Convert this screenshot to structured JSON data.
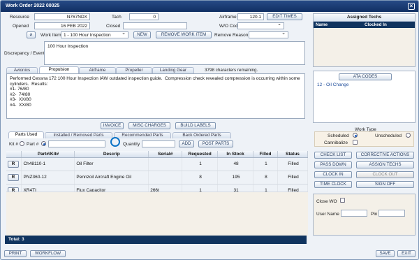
{
  "window": {
    "title": "Work Order 2022 00025",
    "close_icon": "close-icon"
  },
  "header": {
    "resource_label": "Resource",
    "resource_value": "N767NDX",
    "tach_label": "Tach",
    "tach_value": "0",
    "airframe_label": "Airframe",
    "airframe_value": "120.1",
    "edit_times": "EDIT TIMES",
    "opened_label": "Opened",
    "opened_value": "16 FEB 2022",
    "closed_label": "Closed",
    "closed_value": "",
    "wo_code_label": "W/O Code",
    "wo_code_value": ""
  },
  "workitem": {
    "label": "Work Item",
    "value": "1 - 100 Hour Inspection",
    "new_button": "NEW",
    "remove_button": "REMOVE WORK ITEM",
    "remove_reason_label": "Remove Reason",
    "remove_reason_value": ""
  },
  "discrepancy": {
    "label": "Discrepancy / Event",
    "text": "100 Hour Inspection"
  },
  "tabs": [
    "Avionics",
    "Propulsion",
    "Airframe",
    "Propeller",
    "Landing Gear"
  ],
  "chars_remaining": "3798 characters remaining.",
  "note_text": "Performed Cessna 172 100 Hour Inspection IAW outdated inspection guide.  Compression check revealed compression is occurring within some\ncylinders.  Results:\n#1- 76/80\n#2-  74/80\n#3-  XX/80\n#4-  XX/80",
  "actions": {
    "invoice": "INVOICE",
    "misc": "MISC CHARGES",
    "build": "BUILD LABELS"
  },
  "parts_tabs": [
    "Parts Used",
    "Installed / Removed Parts",
    "Recommended Parts",
    "Back Ordered Parts"
  ],
  "parts_controls": {
    "kit_label": "Kit #",
    "part_label": "Part #",
    "quantity_label": "Quantity",
    "add": "ADD",
    "post_parts": "POST PARTS"
  },
  "table": {
    "headers": [
      "Part#/Kit#",
      "Descrip",
      "Serial#",
      "Requested",
      "In Stock",
      "Filled",
      "Status"
    ],
    "rows": [
      {
        "r": "R",
        "part": "Ch48110-1",
        "descrip": "Oil Filter",
        "serial": "",
        "requested": "1",
        "stock": "48",
        "filled": "1",
        "status": "Filled"
      },
      {
        "r": "R",
        "part": "PNZ360-12",
        "descrip": "Pennzoil Aircraft Engine Oil",
        "serial": "",
        "requested": "8",
        "stock": "195",
        "filled": "8",
        "status": "Filled"
      },
      {
        "r": "R",
        "part": "XR4TI",
        "descrip": "Flux Capacitor",
        "serial": "266t",
        "requested": "1",
        "stock": "31",
        "filled": "1",
        "status": "Filled"
      }
    ],
    "total": "Total: 3"
  },
  "assigned_techs": {
    "title": "Assigned Techs",
    "name_col": "Name",
    "clocked_col": "Clocked In"
  },
  "ata": {
    "button": "ATA CODES",
    "item": "12 - Oil Change"
  },
  "work_type": {
    "title": "Work Type",
    "scheduled": "Scheduled",
    "unscheduled": "Unscheduled",
    "cannibalize": "Cannibalize"
  },
  "side_buttons": [
    "CHECK LIST",
    "CORRECTIVE ACTIONS",
    "PASS DOWN",
    "ASSIGN TECHS",
    "CLOCK IN",
    "CLOCK OUT",
    "TIME CLOCK",
    "SIGN OFF"
  ],
  "close_wo": {
    "label": "Close WO",
    "user_label": "User Name",
    "pin_label": "Pin"
  },
  "footer": {
    "print": "PRINT",
    "workflow": "WORKFLOW",
    "save": "SAVE",
    "exit": "EXIT"
  }
}
